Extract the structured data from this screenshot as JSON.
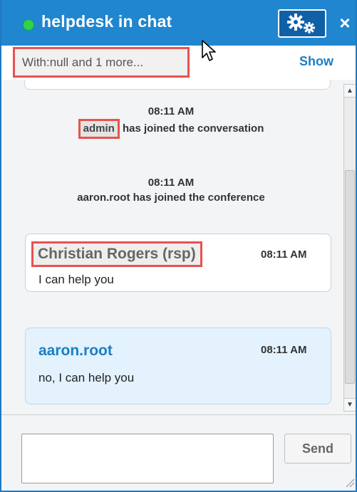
{
  "window": {
    "title": "helpdesk in chat",
    "status_color": "#2fd44a"
  },
  "header": {
    "settings_icon": "gears-icon",
    "close_label": "×"
  },
  "participants": {
    "with_text": "With:null and 1 more...",
    "show_label": "Show"
  },
  "messages": {
    "system": [
      {
        "time": "08:11 AM",
        "user": "admin",
        "text": "has joined the conversation"
      },
      {
        "time": "08:11 AM",
        "text": "aaron.root has joined the conference"
      }
    ],
    "chat": [
      {
        "sender": "Christian Rogers (rsp)",
        "time": "08:11 AM",
        "text": "I can help you"
      },
      {
        "sender": "aaron.root",
        "time": "08:11 AM",
        "text": "no, I can help you"
      }
    ]
  },
  "composer": {
    "input_value": "",
    "send_label": "Send"
  },
  "colors": {
    "accent": "#1f86cf",
    "highlight": "#e8524f",
    "link": "#1a7ec8"
  }
}
